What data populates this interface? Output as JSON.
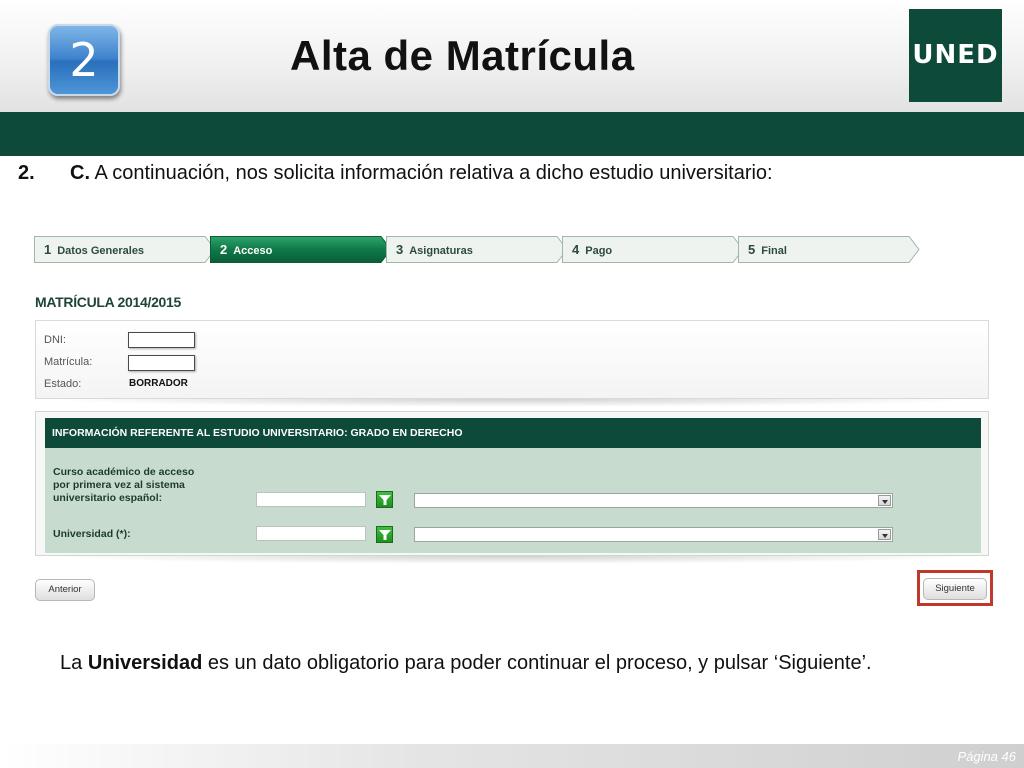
{
  "header": {
    "step_number": "2",
    "title": "Alta de Matrícula",
    "logo_text": "UNED",
    "brand_color": "#0d4a39"
  },
  "instruction": {
    "number": "2.",
    "letter": "C.",
    "text": " A continuación, nos solicita información relativa a dicho estudio universitario:"
  },
  "steps": [
    {
      "number": "1",
      "label": "Datos Generales",
      "active": false
    },
    {
      "number": "2",
      "label": "Acceso",
      "active": true
    },
    {
      "number": "3",
      "label": "Asignaturas",
      "active": false
    },
    {
      "number": "4",
      "label": "Pago",
      "active": false
    },
    {
      "number": "5",
      "label": "Final",
      "active": false
    }
  ],
  "matricula": {
    "title": "MATRÍCULA 2014/2015",
    "dni_label": "DNI:",
    "dni_value": "",
    "matricula_label": "Matrícula:",
    "matricula_value": "",
    "estado_label": "Estado:",
    "estado_value": "BORRADOR"
  },
  "estudio": {
    "header": "INFORMACIÓN REFERENTE AL ESTUDIO UNIVERSITARIO: GRADO EN DERECHO",
    "curso_label_lines": [
      "Curso académico de acceso",
      "por primera vez al sistema",
      "universitario español:"
    ],
    "curso_code_value": "",
    "curso_select_value": "",
    "universidad_label": "Universidad (*):",
    "universidad_code_value": "",
    "universidad_select_value": ""
  },
  "buttons": {
    "anterior": "Anterior",
    "siguiente": "Siguiente",
    "highlight_color": "#c0392b"
  },
  "note": {
    "prefix": "La ",
    "bold": "Universidad",
    "suffix": " es un dato obligatorio para poder continuar el proceso, y pulsar ‘Siguiente’."
  },
  "footer": {
    "page_label": "Página 46"
  }
}
